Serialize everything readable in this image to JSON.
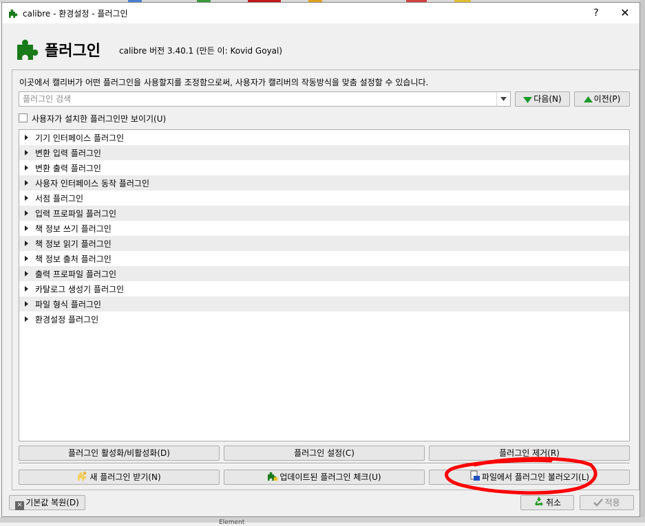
{
  "window": {
    "title": "calibre - 환경설정 - 플러그인",
    "help_label": "?",
    "close_label": "✕"
  },
  "header": {
    "title": "플러그인",
    "version": "calibre 버전 3.40.1 (만든 이: Kovid Goyal)"
  },
  "description": "이곳에서 캘리버가 어떤 플러그인을 사용할지를 조정함으로써, 사용자가 캘리버의 작동방식을 맞춤 설정할 수 있습니다.",
  "search": {
    "placeholder": "플러그인 검색",
    "value": "",
    "next_label": "다음(N)",
    "prev_label": "이전(P)"
  },
  "filter": {
    "label": "사용자가 설치한 플러그인만 보이기(U)",
    "checked": false
  },
  "categories": [
    "기기 인터페이스 플러그인",
    "변환 입력 플러그인",
    "변환 출력 플러그인",
    "사용자 인터페이스 동작 플러그인",
    "서점 플러그인",
    "입력 프로파일 플러그인",
    "책 정보 쓰기 플러그인",
    "책 정보 읽기 플러그인",
    "책 정보 출처 플러그인",
    "출력 프로파일 플러그인",
    "카탈로그 생성기 플러그인",
    "파일 형식 플러그인",
    "환경설정 플러그인"
  ],
  "actions": {
    "toggle_label": "플러그인 활성화/비활성화(D)",
    "settings_label": "플러그인 설정(C)",
    "remove_label": "플러그인 제거(R)",
    "get_new_label": "새 플러그인 받기(N)",
    "check_updates_label": "업데이트된 플러그인 체크(U)",
    "load_from_file_label": "파일에서 플러그인 불러오기(L)"
  },
  "footer": {
    "restore_label": "기본값 복원(D)",
    "cancel_label": "취소",
    "apply_label": "적용"
  },
  "background_text": "Element",
  "colors": {
    "accent_green": "#1a7a1a",
    "annotation_red": "#ff0000"
  }
}
